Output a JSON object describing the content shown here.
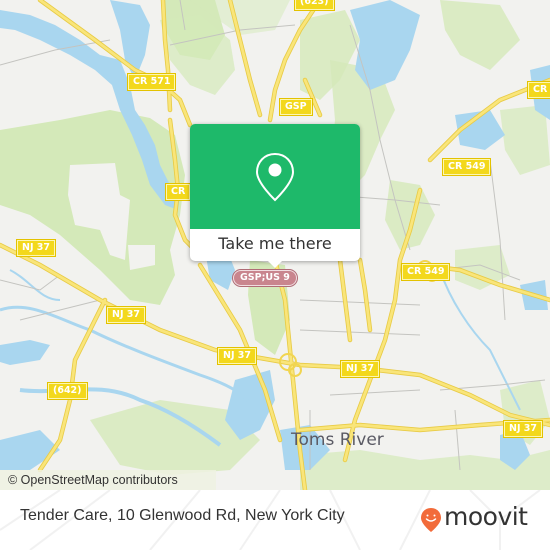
{
  "map": {
    "colors": {
      "land": "#f2f2ef",
      "park": "#d4e9b9",
      "water": "#a9d6ef",
      "road_major": "#f7de5e",
      "road_minor": "#c4c4c0",
      "shield_bg": "#f3d81c",
      "motorway_shield_bg": "#c9858e"
    },
    "road_labels": [
      {
        "id": "cr571",
        "text": "CR 571",
        "type": "county"
      },
      {
        "id": "cr-left",
        "text": "CR",
        "type": "county"
      },
      {
        "id": "gsp-top",
        "text": "GSP",
        "type": "county"
      },
      {
        "id": "r623",
        "text": "(623)",
        "type": "county"
      },
      {
        "id": "cr549-top",
        "text": "CR 549",
        "type": "county"
      },
      {
        "id": "cr-right",
        "text": "CR",
        "type": "county"
      },
      {
        "id": "cr549-mid",
        "text": "CR 549",
        "type": "county"
      },
      {
        "id": "nj37-a",
        "text": "NJ 37",
        "type": "state"
      },
      {
        "id": "nj37-b",
        "text": "NJ 37",
        "type": "state"
      },
      {
        "id": "nj37-c",
        "text": "NJ 37",
        "type": "state"
      },
      {
        "id": "nj37-d",
        "text": "NJ 37",
        "type": "state"
      },
      {
        "id": "nj37-e",
        "text": "NJ 37",
        "type": "state"
      },
      {
        "id": "r642",
        "text": "(642)",
        "type": "county"
      },
      {
        "id": "gsp-us9",
        "text": "GSP;US 9",
        "type": "motorway"
      }
    ],
    "place_labels": [
      {
        "id": "toms-river",
        "text": "Toms River"
      }
    ],
    "attribution": "© OpenStreetMap contributors"
  },
  "popup": {
    "icon": "map-pin-icon",
    "action_label": "Take me there",
    "color": "#1eb96a"
  },
  "footer": {
    "address": "Tender Care, 10 Glenwood Rd, New York City",
    "brand": {
      "name": "moovit",
      "icon": "moovit-smiley-pin-icon",
      "color": "#f26b3a"
    }
  }
}
